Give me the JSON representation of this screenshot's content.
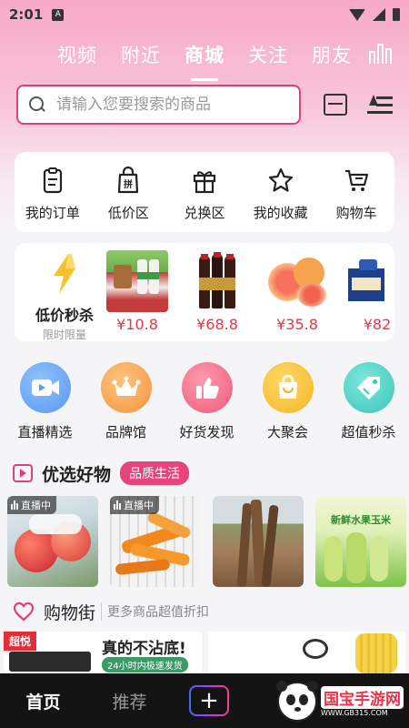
{
  "status_bar": {
    "time": "2:01",
    "notification_letter": "A"
  },
  "top_tabs": [
    {
      "label": "视频",
      "active": false
    },
    {
      "label": "附近",
      "active": false
    },
    {
      "label": "商城",
      "active": true
    },
    {
      "label": "关注",
      "active": false
    },
    {
      "label": "朋友",
      "active": false
    }
  ],
  "search": {
    "placeholder": "请输入您要搜索的商品",
    "accent": "#e13f7b"
  },
  "quick_actions": [
    {
      "label": "我的订单",
      "icon": "clipboard-icon"
    },
    {
      "label": "低价区",
      "icon": "bag-icon",
      "icon_text": "拼"
    },
    {
      "label": "兑换区",
      "icon": "gift-icon"
    },
    {
      "label": "我的收藏",
      "icon": "star-icon"
    },
    {
      "label": "购物车",
      "icon": "cart-icon"
    }
  ],
  "flash_sale": {
    "title": "低价秒杀",
    "subtitle": "限时限量",
    "products": [
      {
        "price": "¥10.8",
        "image": "picnic-milk"
      },
      {
        "price": "¥68.8",
        "image": "soy-sauce-bottles"
      },
      {
        "price": "¥35.8",
        "image": "grapefruit"
      },
      {
        "price": "¥82",
        "image": "tea-box"
      }
    ]
  },
  "categories": [
    {
      "label": "直播精选",
      "icon": "video-camera-icon",
      "color": "#6aa8f5"
    },
    {
      "label": "品牌馆",
      "icon": "crown-icon",
      "color": "#f5a04e"
    },
    {
      "label": "好货发现",
      "icon": "thumbs-up-icon",
      "color": "#f26a86"
    },
    {
      "label": "大聚会",
      "icon": "shopping-bag-icon",
      "color": "#f7c13a"
    },
    {
      "label": "超值秒杀",
      "icon": "tag-icon",
      "color": "#4fd1c5"
    }
  ],
  "featured": {
    "title": "优选好物",
    "badge": "品质生活",
    "items": [
      {
        "image": "apples",
        "live_label": "直播中"
      },
      {
        "image": "dried-sweet-potato",
        "live_label": "直播中"
      },
      {
        "image": "yam-field",
        "live_label": ""
      },
      {
        "image": "fresh-corn",
        "live_label": "",
        "caption": "新鲜水果玉米"
      }
    ]
  },
  "shopping_street": {
    "title": "购物街",
    "subtitle": "更多商品超值折扣"
  },
  "banner": {
    "tag": "超悦",
    "headline": "真的不沾底!",
    "sub": "24小时内极速发货"
  },
  "bottom_nav": {
    "home": "首页",
    "recommend": "推荐",
    "plus": "+"
  },
  "watermark": {
    "text": "国宝手游网",
    "url": "WWW.GB315.COM"
  }
}
